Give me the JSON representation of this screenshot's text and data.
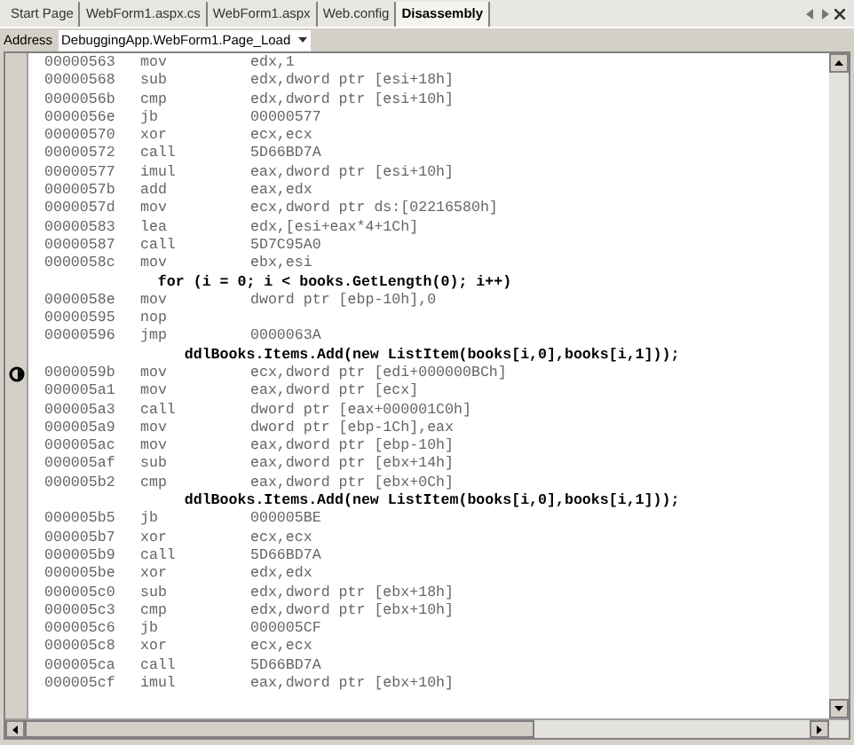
{
  "tabs": [
    {
      "label": "Start Page",
      "selected": false
    },
    {
      "label": "WebForm1.aspx.cs",
      "selected": false
    },
    {
      "label": "WebForm1.aspx",
      "selected": false
    },
    {
      "label": "Web.config",
      "selected": false
    },
    {
      "label": "Disassembly",
      "selected": true
    }
  ],
  "address": {
    "label": "Address",
    "value": "DebuggingApp.WebForm1.Page_Load"
  },
  "lines": [
    {
      "kind": "asm",
      "address": "00000563",
      "op": "mov",
      "operands": "edx,1",
      "current": false
    },
    {
      "kind": "asm",
      "address": "00000568",
      "op": "sub",
      "operands": "edx,dword ptr [esi+18h]",
      "current": false
    },
    {
      "kind": "asm",
      "address": "0000056b",
      "op": "cmp",
      "operands": "edx,dword ptr [esi+10h]",
      "current": false
    },
    {
      "kind": "asm",
      "address": "0000056e",
      "op": "jb",
      "operands": "00000577",
      "current": false
    },
    {
      "kind": "asm",
      "address": "00000570",
      "op": "xor",
      "operands": "ecx,ecx",
      "current": false
    },
    {
      "kind": "asm",
      "address": "00000572",
      "op": "call",
      "operands": "5D66BD7A",
      "current": false
    },
    {
      "kind": "asm",
      "address": "00000577",
      "op": "imul",
      "operands": "eax,dword ptr [esi+10h]",
      "current": false
    },
    {
      "kind": "asm",
      "address": "0000057b",
      "op": "add",
      "operands": "eax,edx",
      "current": false
    },
    {
      "kind": "asm",
      "address": "0000057d",
      "op": "mov",
      "operands": "ecx,dword ptr ds:[02216580h]",
      "current": false
    },
    {
      "kind": "asm",
      "address": "00000583",
      "op": "lea",
      "operands": "edx,[esi+eax*4+1Ch]",
      "current": false
    },
    {
      "kind": "asm",
      "address": "00000587",
      "op": "call",
      "operands": "5D7C95A0",
      "current": false
    },
    {
      "kind": "asm",
      "address": "0000058c",
      "op": "mov",
      "operands": "ebx,esi",
      "current": false
    },
    {
      "kind": "source",
      "text": "   for (i = 0; i < books.GetLength(0); i++)"
    },
    {
      "kind": "asm",
      "address": "0000058e",
      "op": "mov",
      "operands": "dword ptr [ebp-10h],0",
      "current": false
    },
    {
      "kind": "asm",
      "address": "00000595",
      "op": "nop",
      "current": false
    },
    {
      "kind": "asm",
      "address": "00000596",
      "op": "jmp",
      "operands": "0000063A",
      "current": false
    },
    {
      "kind": "source",
      "text": "      ddlBooks.Items.Add(new ListItem(books[i,0],books[i,1]));"
    },
    {
      "kind": "asm",
      "address": "0000059b",
      "op": "mov",
      "operands": "ecx,dword ptr [edi+000000BCh]",
      "current": true
    },
    {
      "kind": "asm",
      "address": "000005a1",
      "op": "mov",
      "operands": "eax,dword ptr [ecx]",
      "current": false
    },
    {
      "kind": "asm",
      "address": "000005a3",
      "op": "call",
      "operands": "dword ptr [eax+000001C0h]",
      "current": false
    },
    {
      "kind": "asm",
      "address": "000005a9",
      "op": "mov",
      "operands": "dword ptr [ebp-1Ch],eax",
      "current": false
    },
    {
      "kind": "asm",
      "address": "000005ac",
      "op": "mov",
      "operands": "eax,dword ptr [ebp-10h]",
      "current": false
    },
    {
      "kind": "asm",
      "address": "000005af",
      "op": "sub",
      "operands": "eax,dword ptr [ebx+14h]",
      "current": false
    },
    {
      "kind": "asm",
      "address": "000005b2",
      "op": "cmp",
      "operands": "eax,dword ptr [ebx+0Ch]",
      "current": false
    },
    {
      "kind": "source",
      "text": "      ddlBooks.Items.Add(new ListItem(books[i,0],books[i,1]));"
    },
    {
      "kind": "asm",
      "address": "000005b5",
      "op": "jb",
      "operands": "000005BE",
      "current": false
    },
    {
      "kind": "asm",
      "address": "000005b7",
      "op": "xor",
      "operands": "ecx,ecx",
      "current": false
    },
    {
      "kind": "asm",
      "address": "000005b9",
      "op": "call",
      "operands": "5D66BD7A",
      "current": false
    },
    {
      "kind": "asm",
      "address": "000005be",
      "op": "xor",
      "operands": "edx,edx",
      "current": false
    },
    {
      "kind": "asm",
      "address": "000005c0",
      "op": "sub",
      "operands": "edx,dword ptr [ebx+18h]",
      "current": false
    },
    {
      "kind": "asm",
      "address": "000005c3",
      "op": "cmp",
      "operands": "edx,dword ptr [ebx+10h]",
      "current": false
    },
    {
      "kind": "asm",
      "address": "000005c6",
      "op": "jb",
      "operands": "000005CF",
      "current": false
    },
    {
      "kind": "asm",
      "address": "000005c8",
      "op": "xor",
      "operands": "ecx,ecx",
      "current": false
    },
    {
      "kind": "asm",
      "address": "000005ca",
      "op": "call",
      "operands": "5D66BD7A",
      "current": false
    },
    {
      "kind": "asm",
      "address": "000005cf",
      "op": "imul",
      "operands": "eax,dword ptr [ebx+10h]",
      "current": false
    }
  ]
}
